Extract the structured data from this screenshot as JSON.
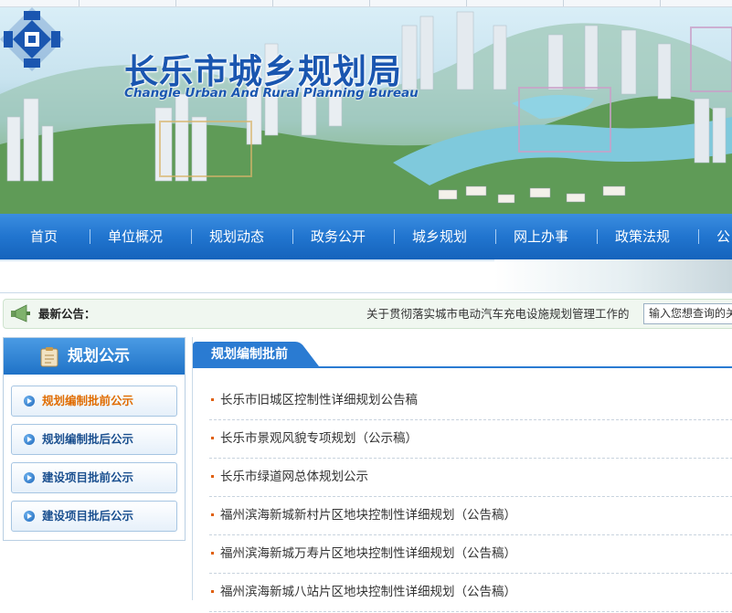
{
  "header": {
    "title_cn": "长乐市城乡规划局",
    "title_en": "Changle Urban And Rural Planning Bureau",
    "logo_icon": "bureau-emblem-icon"
  },
  "nav": {
    "items": [
      {
        "label": "首页"
      },
      {
        "label": "单位概况"
      },
      {
        "label": "规划动态"
      },
      {
        "label": "政务公开"
      },
      {
        "label": "城乡规划"
      },
      {
        "label": "网上办事"
      },
      {
        "label": "政策法规"
      },
      {
        "label": "公"
      }
    ]
  },
  "notice": {
    "icon": "megaphone-icon",
    "label": "最新公告：",
    "text": "关于贯彻落实城市电动汽车充电设施规划管理工作的",
    "search_value": "输入您想查询的关"
  },
  "sidebar": {
    "title": "规划公示",
    "icon": "document-icon",
    "items": [
      {
        "label": "规划编制批前公示",
        "active": true
      },
      {
        "label": "规划编制批后公示",
        "active": false
      },
      {
        "label": "建设项目批前公示",
        "active": false
      },
      {
        "label": "建设项目批后公示",
        "active": false
      }
    ]
  },
  "main": {
    "tab_title": "规划编制批前",
    "list": [
      {
        "title": "长乐市旧城区控制性详细规划公告稿"
      },
      {
        "title": "长乐市景观风貌专项规划（公示稿）"
      },
      {
        "title": "长乐市绿道网总体规划公示"
      },
      {
        "title": "福州滨海新城新村片区地块控制性详细规划（公告稿）"
      },
      {
        "title": "福州滨海新城万寿片区地块控制性详细规划（公告稿）"
      },
      {
        "title": "福州滨海新城八站片区地块控制性详细规划（公告稿）"
      }
    ]
  },
  "colors": {
    "nav_blue": "#2175cf",
    "title_blue": "#1a56b0",
    "active_orange": "#e06c00",
    "bullet_red": "#e0600f"
  }
}
